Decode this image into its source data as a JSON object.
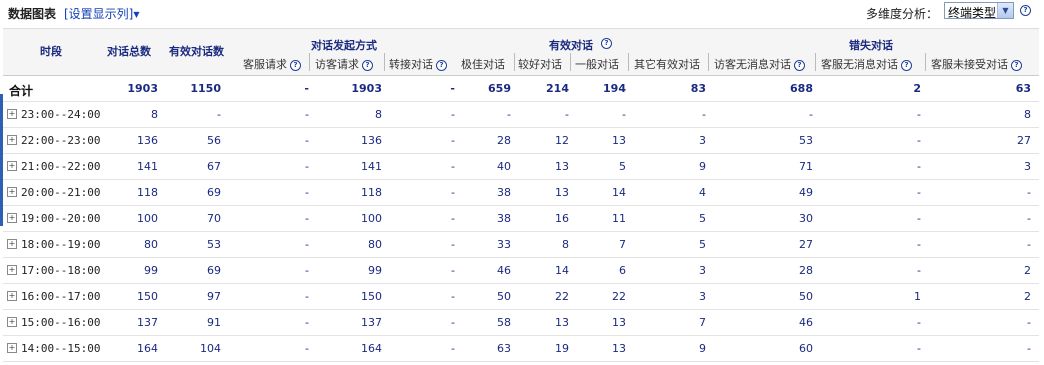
{
  "toolbar": {
    "title": "数据图表",
    "set_columns": "[设置显示列]",
    "multi_label": "多维度分析：",
    "dimension_value": "终端类型",
    "help": "?"
  },
  "header": {
    "time": "时段",
    "total": "对话总数",
    "valid": "有效对话数",
    "group_initiate": "对话发起方式",
    "group_valid": "有效对话",
    "group_lost": "错失对话",
    "sub": {
      "agent_req": "客服请求",
      "visitor_req": "访客请求",
      "transfer": "转接对话",
      "best": "极佳对话",
      "good": "较好对话",
      "normal": "一般对话",
      "other_valid": "其它有效对话",
      "visitor_nomsg": "访客无消息对话",
      "agent_nomsg": "客服无消息对话",
      "agent_noaccept": "客服未接受对话"
    }
  },
  "total_row": {
    "label": "合计",
    "values": [
      "1903",
      "1150",
      "-",
      "1903",
      "-",
      "659",
      "214",
      "194",
      "83",
      "688",
      "2",
      "63"
    ]
  },
  "rows": [
    {
      "time": "23:00--24:00",
      "values": [
        "8",
        "-",
        "-",
        "8",
        "-",
        "-",
        "-",
        "-",
        "-",
        "-",
        "-",
        "8"
      ]
    },
    {
      "time": "22:00--23:00",
      "values": [
        "136",
        "56",
        "-",
        "136",
        "-",
        "28",
        "12",
        "13",
        "3",
        "53",
        "-",
        "27"
      ]
    },
    {
      "time": "21:00--22:00",
      "values": [
        "141",
        "67",
        "-",
        "141",
        "-",
        "40",
        "13",
        "5",
        "9",
        "71",
        "-",
        "3"
      ]
    },
    {
      "time": "20:00--21:00",
      "values": [
        "118",
        "69",
        "-",
        "118",
        "-",
        "38",
        "13",
        "14",
        "4",
        "49",
        "-",
        "-"
      ]
    },
    {
      "time": "19:00--20:00",
      "values": [
        "100",
        "70",
        "-",
        "100",
        "-",
        "38",
        "16",
        "11",
        "5",
        "30",
        "-",
        "-"
      ]
    },
    {
      "time": "18:00--19:00",
      "values": [
        "80",
        "53",
        "-",
        "80",
        "-",
        "33",
        "8",
        "7",
        "5",
        "27",
        "-",
        "-"
      ]
    },
    {
      "time": "17:00--18:00",
      "values": [
        "99",
        "69",
        "-",
        "99",
        "-",
        "46",
        "14",
        "6",
        "3",
        "28",
        "-",
        "2"
      ]
    },
    {
      "time": "16:00--17:00",
      "values": [
        "150",
        "97",
        "-",
        "150",
        "-",
        "50",
        "22",
        "22",
        "3",
        "50",
        "1",
        "2"
      ]
    },
    {
      "time": "15:00--16:00",
      "values": [
        "137",
        "91",
        "-",
        "137",
        "-",
        "58",
        "13",
        "13",
        "7",
        "46",
        "-",
        "-"
      ]
    },
    {
      "time": "14:00--15:00",
      "values": [
        "164",
        "104",
        "-",
        "164",
        "-",
        "63",
        "19",
        "13",
        "9",
        "60",
        "-",
        "-"
      ]
    }
  ]
}
